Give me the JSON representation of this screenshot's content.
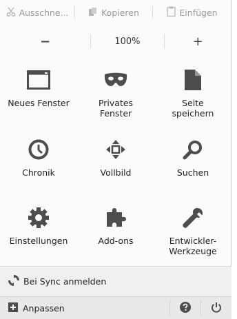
{
  "edit": {
    "cut_label": "Ausschne...",
    "copy_label": "Kopieren",
    "paste_label": "Einfügen"
  },
  "zoom": {
    "minus_label": "−",
    "level": "100%",
    "plus_label": "+"
  },
  "tiles": [
    {
      "label": "Neues Fenster",
      "icon": "window-icon"
    },
    {
      "label": "Privates\nFenster",
      "icon": "mask-icon"
    },
    {
      "label": "Seite\nspeichern",
      "icon": "page-icon"
    },
    {
      "label": "Chronik",
      "icon": "clock-icon"
    },
    {
      "label": "Vollbild",
      "icon": "fullscreen-icon"
    },
    {
      "label": "Suchen",
      "icon": "search-icon"
    },
    {
      "label": "Einstellungen",
      "icon": "gear-icon"
    },
    {
      "label": "Add-ons",
      "icon": "puzzle-icon"
    },
    {
      "label": "Entwickler-\nWerkzeuge",
      "icon": "wrench-icon"
    }
  ],
  "sync": {
    "label": "Bei Sync anmelden"
  },
  "footer": {
    "customize_label": "Anpassen"
  },
  "colors": {
    "icon": "#4d4d4d",
    "panel_bg": "#fbfbfb",
    "footer_bg": "#e8e8e8"
  }
}
